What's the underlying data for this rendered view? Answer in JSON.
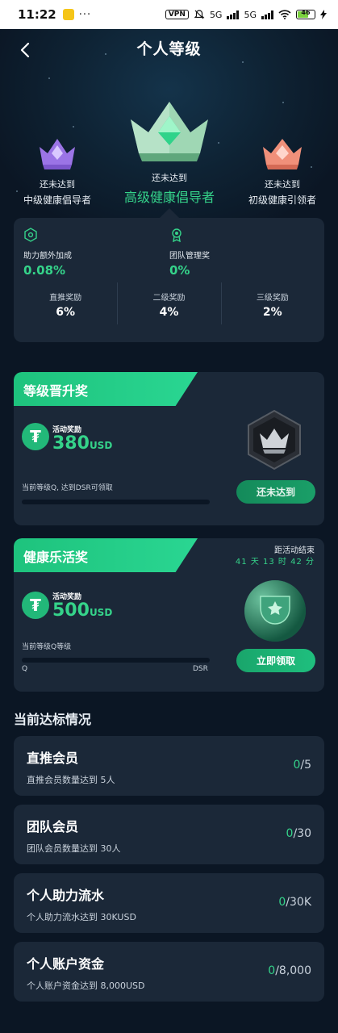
{
  "status_bar": {
    "time": "11:22",
    "more": "···",
    "vpn": "VPN",
    "net1": "5G",
    "net2": "5G",
    "battery": "46"
  },
  "header": {
    "title": "个人等级"
  },
  "levels": [
    {
      "status": "还未达到",
      "name": "中级健康倡导者"
    },
    {
      "status": "还未达到",
      "name": "高级健康倡导者"
    },
    {
      "status": "还未达到",
      "name": "初级健康引领者"
    }
  ],
  "info": {
    "boost": {
      "label": "助力额外加成",
      "value": "0.08%"
    },
    "team": {
      "label": "团队管理奖",
      "value": "0%"
    },
    "rewards": [
      {
        "label": "直推奖励",
        "value": "6%"
      },
      {
        "label": "二级奖励",
        "value": "4%"
      },
      {
        "label": "三级奖励",
        "value": "2%"
      }
    ]
  },
  "promo1": {
    "tag": "等级晋升奖",
    "activity_label": "活动奖励",
    "amount": "380",
    "unit": "USD",
    "desc": "当前等级Q, 达到DSR可领取",
    "progress": 0,
    "button": "还未达到"
  },
  "promo2": {
    "tag": "健康乐活奖",
    "countdown_label": "距活动结束",
    "countdown": "41 天 13 时 42 分",
    "activity_label": "活动奖励",
    "amount": "500",
    "unit": "USD",
    "desc": "当前等级Q等级",
    "start_label": "Q",
    "end_label": "DSR",
    "progress": 0,
    "button": "立即领取"
  },
  "section": {
    "title": "当前达标情况"
  },
  "tasks": [
    {
      "title": "直推会员",
      "desc": "直推会员数量达到 5人",
      "current": "0",
      "target": "/5"
    },
    {
      "title": "团队会员",
      "desc": "团队会员数量达到 30人",
      "current": "0",
      "target": "/30"
    },
    {
      "title": "个人助力流水",
      "desc": "个人助力流水达到 30KUSD",
      "current": "0",
      "target": "/30K"
    },
    {
      "title": "个人账户资金",
      "desc": "个人账户资金达到 8,000USD",
      "current": "0",
      "target": "/8,000"
    }
  ],
  "colors": {
    "accent": "#35d38a",
    "card": "#1b2838",
    "background": "#0b1624"
  }
}
